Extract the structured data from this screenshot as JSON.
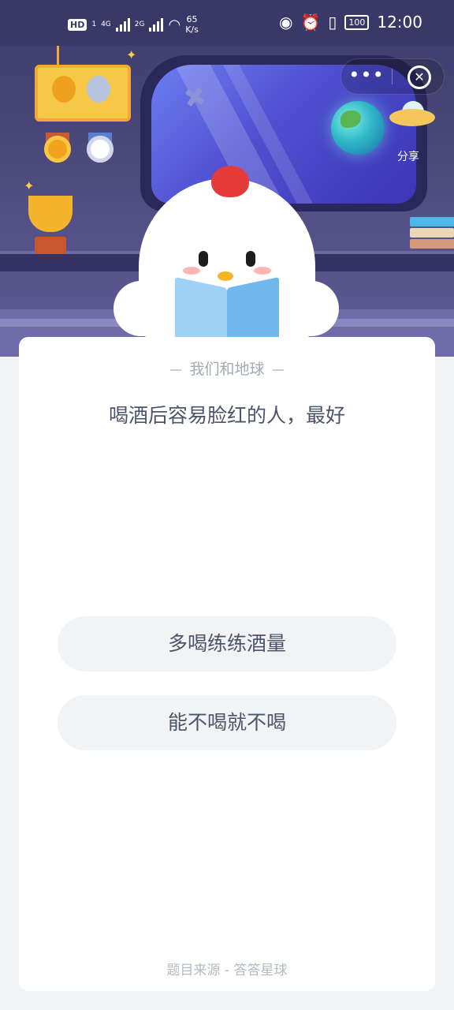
{
  "status_bar": {
    "hd": "HD",
    "sim1": "1",
    "net1": "4G",
    "net2": "2G",
    "speed_value": "65",
    "speed_unit": "K/s",
    "battery": "100",
    "time": "12:00"
  },
  "capsule": {
    "more_label": "•••",
    "close_label": "✕"
  },
  "header": {
    "share_label": "分享"
  },
  "card": {
    "topic": "我们和地球",
    "question": "喝酒后容易脸红的人，最好",
    "options": [
      {
        "label": "多喝练练酒量"
      },
      {
        "label": "能不喝就不喝"
      }
    ],
    "source": "题目来源 - 答答星球"
  },
  "colors": {
    "scene_bg": "#4a4878",
    "card_bg": "#ffffff",
    "option_bg": "#f2f3f5",
    "text_primary": "#4b556a",
    "text_muted": "#a4a9b3"
  }
}
